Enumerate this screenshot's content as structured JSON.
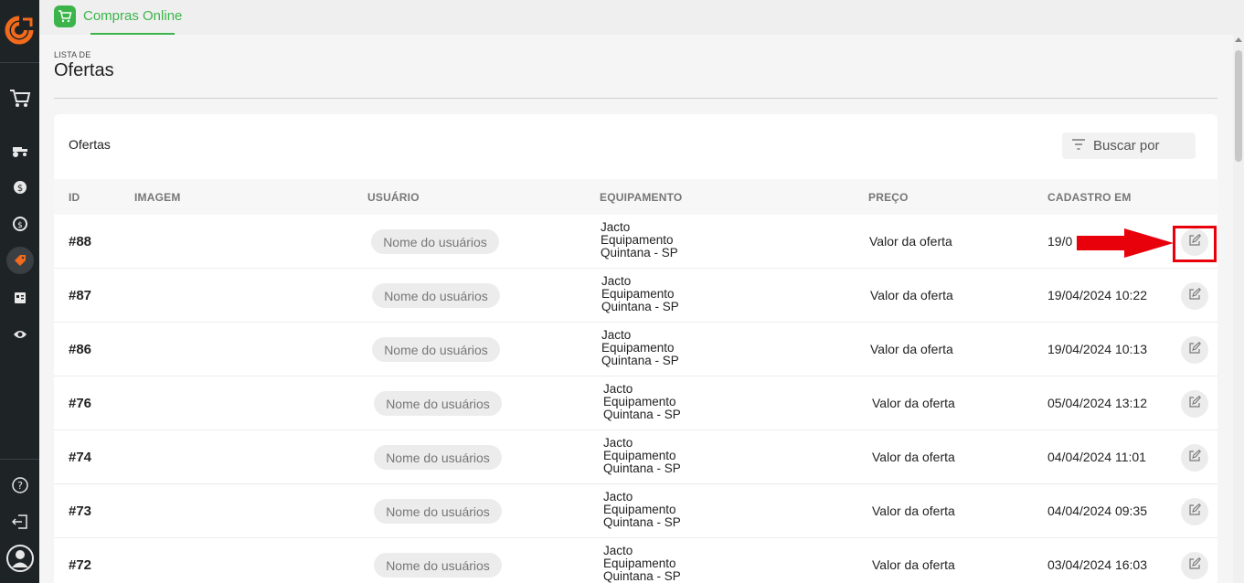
{
  "sidebar": {
    "logo": "company-logo",
    "icons": [
      "cart-icon",
      "tractor-icon",
      "money-icon",
      "money-cycle-icon",
      "tag-icon",
      "id-card-icon",
      "eye-icon"
    ],
    "bottom_icons": [
      "help-icon",
      "logout-icon",
      "user-avatar-icon"
    ]
  },
  "topbar": {
    "tab_label": "Compras Online",
    "tab_icon": "cart-icon"
  },
  "page": {
    "crumb": "LISTA DE",
    "title": "Ofertas"
  },
  "card": {
    "title": "Ofertas",
    "search_placeholder": "Buscar por"
  },
  "table": {
    "columns": {
      "id": "ID",
      "image": "IMAGEM",
      "user": "USUÁRIO",
      "equipment": "EQUIPAMENTO",
      "price": "PREÇO",
      "created": "CADASTRO EM"
    },
    "rows": [
      {
        "id": "#88",
        "user": "Nome do usuários",
        "eq1": "Jacto",
        "eq2": "Equipamento",
        "eq3": "Quintana - SP",
        "price": "Valor da oferta",
        "date": "19/0"
      },
      {
        "id": "#87",
        "user": "Nome do usuários",
        "eq1": "Jacto",
        "eq2": "Equipamento",
        "eq3": "Quintana - SP",
        "price": "Valor da oferta",
        "date": "19/04/2024 10:22"
      },
      {
        "id": "#86",
        "user": "Nome do usuários",
        "eq1": "Jacto",
        "eq2": "Equipamento",
        "eq3": "Quintana - SP",
        "price": "Valor da oferta",
        "date": "19/04/2024 10:13"
      },
      {
        "id": "#76",
        "user": "Nome do usuários",
        "eq1": "Jacto",
        "eq2": "Equipamento",
        "eq3": "Quintana - SP",
        "price": "Valor da oferta",
        "date": "05/04/2024 13:12"
      },
      {
        "id": "#74",
        "user": "Nome do usuários",
        "eq1": "Jacto",
        "eq2": "Equipamento",
        "eq3": "Quintana - SP",
        "price": "Valor da oferta",
        "date": "04/04/2024 11:01"
      },
      {
        "id": "#73",
        "user": "Nome do usuários",
        "eq1": "Jacto",
        "eq2": "Equipamento",
        "eq3": "Quintana - SP",
        "price": "Valor da oferta",
        "date": "04/04/2024 09:35"
      },
      {
        "id": "#72",
        "user": "Nome do usuários",
        "eq1": "Jacto",
        "eq2": "Equipamento",
        "eq3": "Quintana - SP",
        "price": "Valor da oferta",
        "date": "03/04/2024 16:03"
      }
    ]
  },
  "colors": {
    "accent": "#3bb54a",
    "sidebar_bg": "#1e2326",
    "annotation": "#e8000b"
  }
}
